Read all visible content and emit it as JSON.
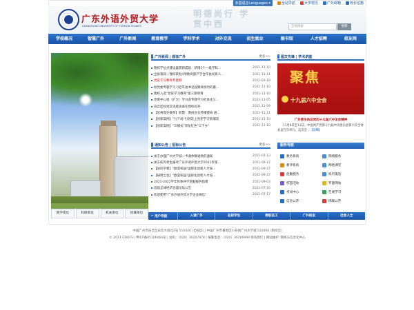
{
  "topbar": {
    "language_label": "多国语言Languages ▾",
    "links": [
      {
        "label": "全站导航",
        "icon": "map-icon",
        "color": "#e08a1e"
      },
      {
        "label": "大学校历",
        "icon": "calendar-icon",
        "color": "#d93d3d"
      },
      {
        "label": "广外邮箱",
        "icon": "mail-icon",
        "color": "#2a6fc0"
      },
      {
        "label": "校长信箱",
        "icon": "letter-icon",
        "color": "#2a6fc0"
      }
    ]
  },
  "header": {
    "logo_cn": "广东外语外贸大学",
    "logo_en": "GUANGDONG UNIVERSITY OF FOREIGN STUDIES",
    "motto": "明德尚行 学贯中西",
    "search_placeholder": "全站搜索",
    "search_button": "搜索"
  },
  "nav": [
    "学校概况",
    "智慧广外",
    "广外新闻",
    "教育教学",
    "学科学术",
    "对外交流",
    "招生就业",
    "图书馆",
    "人才招聘",
    "校友网"
  ],
  "quick_links": [
    "教学单位",
    "科研单位",
    "机关单位",
    "校属单位"
  ],
  "news_section": {
    "title": "广外新闻 | 媒体广外",
    "more": "更多>>",
    "items": [
      {
        "title": "我校学位点建设喜获新成就：新增1个一级学科...",
        "date": "2021-11-10",
        "highlight": false
      },
      {
        "title": "全省第四 | 我校获批4项教育部产学合作协同育人...",
        "date": "2021-11-11",
        "highlight": false
      },
      {
        "title": "党史学习教育专题网",
        "date": "2021-03-18",
        "highlight": true
      },
      {
        "title": "校党委专题学习习近平总书记视察高校时的重...",
        "date": "2021-11-10",
        "highlight": false
      },
      {
        "title": "我校入选\"党史学习教育\"第三期项目",
        "date": "2021-11-10",
        "highlight": false
      },
      {
        "title": "党委中心组（扩大）学习会专题学习社会主义...",
        "date": "2021-11-05",
        "highlight": false
      },
      {
        "title": "白云区校地交流座谈会在我校召开",
        "date": "2021-11-09",
        "highlight": false
      },
      {
        "title": "【优秀现外教师】智慧：勇挑文化传播使命 培...",
        "date": "2021-11-11",
        "highlight": false
      },
      {
        "title": "【创新案例】\"九个局\"引领云上党史学习新潮流",
        "date": "2021-11-10",
        "highlight": false
      },
      {
        "title": "【创新案例】\"三模式\"深化红色\"三下乡\"",
        "date": "2021-11-10",
        "highlight": false
      }
    ]
  },
  "notice_section": {
    "title": "通知公告 | 招标公告",
    "more": "更多>>",
    "items": [
      {
        "title": "关于办理广州大学城一卡通余额退款的通知",
        "date": "2021-07-13"
      },
      {
        "title": "关于校内考生报考广东外语外贸大学2021年第...",
        "date": "2021-09-27"
      },
      {
        "title": "【访问学者】\"欧亚校园\"国际化创新人才培...",
        "date": "2021-09-27"
      },
      {
        "title": "【研博士生】\"欧亚校园\"国际化创新人才培...",
        "date": "2021-09-27"
      },
      {
        "title": "2021-2022学年秋季开学后勤服务指南",
        "date": "2021-09-03"
      },
      {
        "title": "首届全球经济治理论坛公告",
        "date": "2021-07-20"
      },
      {
        "title": "欢迎使用\"广东外语外贸大学企业微信\"",
        "date": "2021-07-17"
      }
    ]
  },
  "focus_section": {
    "title": "图文先锋 | 学术讲座",
    "image_big": "聚焦",
    "image_small": "十九届六中全会",
    "caption": "广外师生热议党的十九届六中全会精神",
    "desc": "11月8日至11日，中国共产党第十九届中央委员会第六次全体会议在京举行。这次全...",
    "more": "【详细】"
  },
  "services": {
    "title": "服务导航",
    "items": [
      {
        "label": "教务系统",
        "icon": "book-icon",
        "color": "#2a6fc0"
      },
      {
        "label": "网络服务",
        "icon": "network-icon",
        "color": "#4b8bd6"
      },
      {
        "label": "教评系统",
        "icon": "evaluation-icon",
        "color": "#e08a1e"
      },
      {
        "label": "网络课堂",
        "icon": "classroom-icon",
        "color": "#4b8bd6"
      },
      {
        "label": "后勤服务",
        "icon": "service-icon",
        "color": "#d93d3d"
      },
      {
        "label": "校内电话",
        "icon": "phone-icon",
        "color": "#4b8bd6"
      },
      {
        "label": "校园活动",
        "icon": "activity-icon",
        "color": "#7a59c9"
      },
      {
        "label": "专题网站",
        "icon": "star-icon",
        "color": "#e0b21e"
      },
      {
        "label": "考试中心",
        "icon": "exam-icon",
        "color": "#2a6fc0"
      },
      {
        "label": "在线学习",
        "icon": "study-icon",
        "color": "#3aa35a"
      },
      {
        "label": "信息公开",
        "icon": "info-icon",
        "color": "#2a6fc0"
      },
      {
        "label": "绑教公开",
        "icon": "public-icon",
        "color": "#d93d3d"
      }
    ]
  },
  "user_nav": {
    "label": "用户导航",
    "items": [
      "入读广外",
      "在校学生",
      "教职员工",
      "广外校友",
      "社会人士"
    ]
  },
  "footer": {
    "line1": "中国广州市白云区白云大道北2号 510420 (北校区) | 中国广州市番禺区小谷围广州大学城 510006 (南校区)",
    "line2": "© 2011 GDUFS | 粤ICP备05106464号 | 总机：（020）36207878 | 报警电话：（020）36206999 联系我们 | 网站维护: 网络与信息化中心"
  }
}
